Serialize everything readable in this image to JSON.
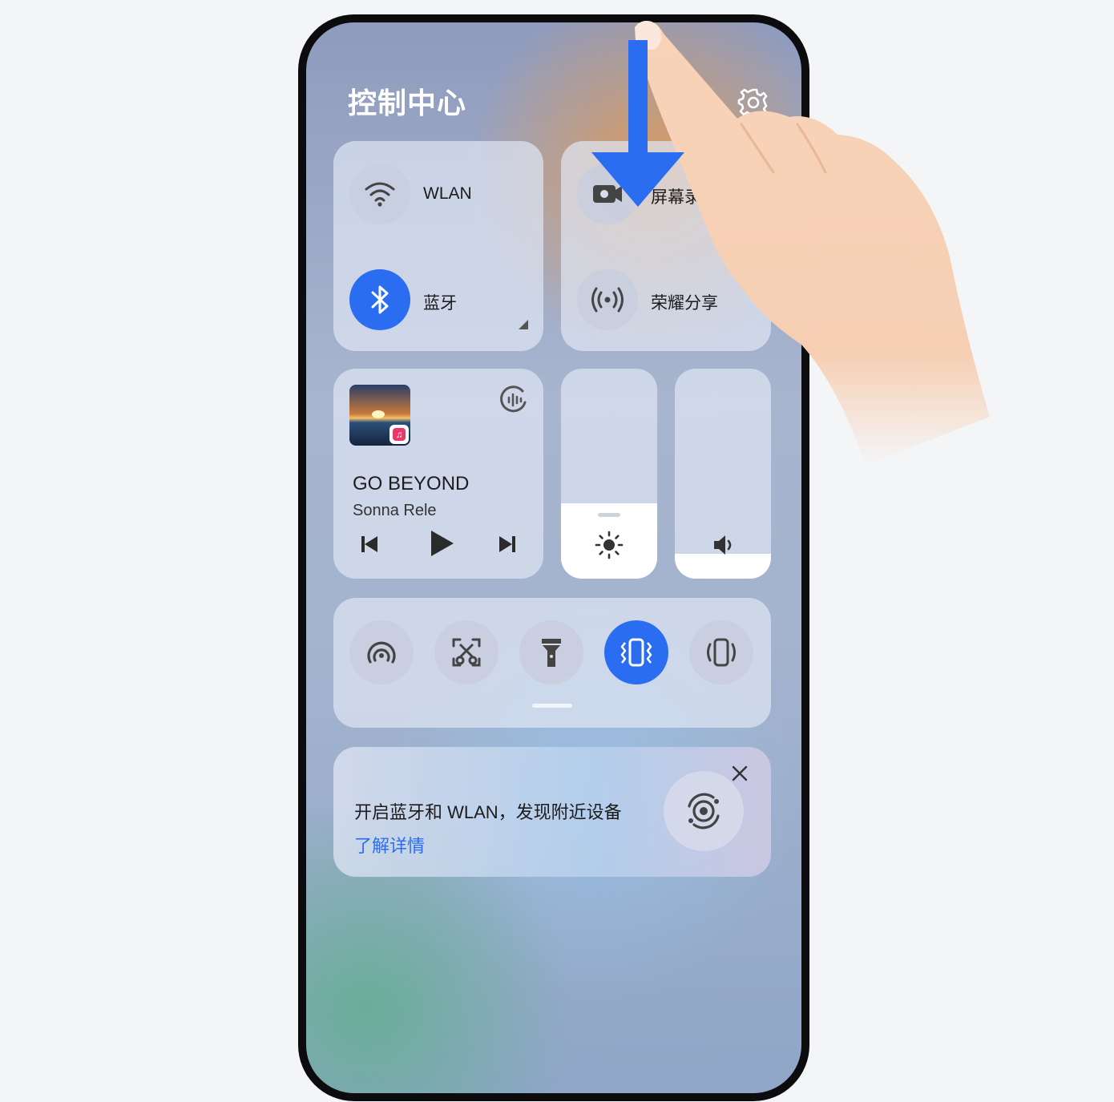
{
  "header": {
    "title": "控制中心",
    "settings_icon": "gear-icon"
  },
  "connectivity": {
    "wlan_label": "WLAN",
    "bluetooth_label": "蓝牙",
    "bluetooth_on": true
  },
  "shortcuts": {
    "screen_record_label": "屏幕录制",
    "honor_share_label": "荣耀分享"
  },
  "media": {
    "title": "GO BEYOND",
    "artist": "Sonna Rele",
    "controls": [
      "previous-icon",
      "play-icon",
      "next-icon"
    ]
  },
  "sliders": {
    "brightness_level": 0.36,
    "volume_level": 0.12
  },
  "quick_toggles": [
    {
      "name": "nfc-icon",
      "active": false
    },
    {
      "name": "screenshot-icon",
      "active": false
    },
    {
      "name": "flashlight-icon",
      "active": false
    },
    {
      "name": "vibrate-icon",
      "active": true
    },
    {
      "name": "ring-mode-icon",
      "active": false
    }
  ],
  "notice": {
    "text": "开启蓝牙和 WLAN，发现附近设备",
    "link": "了解详情"
  },
  "colors": {
    "accent": "#2a6df0",
    "arrow": "#2a6df0"
  }
}
